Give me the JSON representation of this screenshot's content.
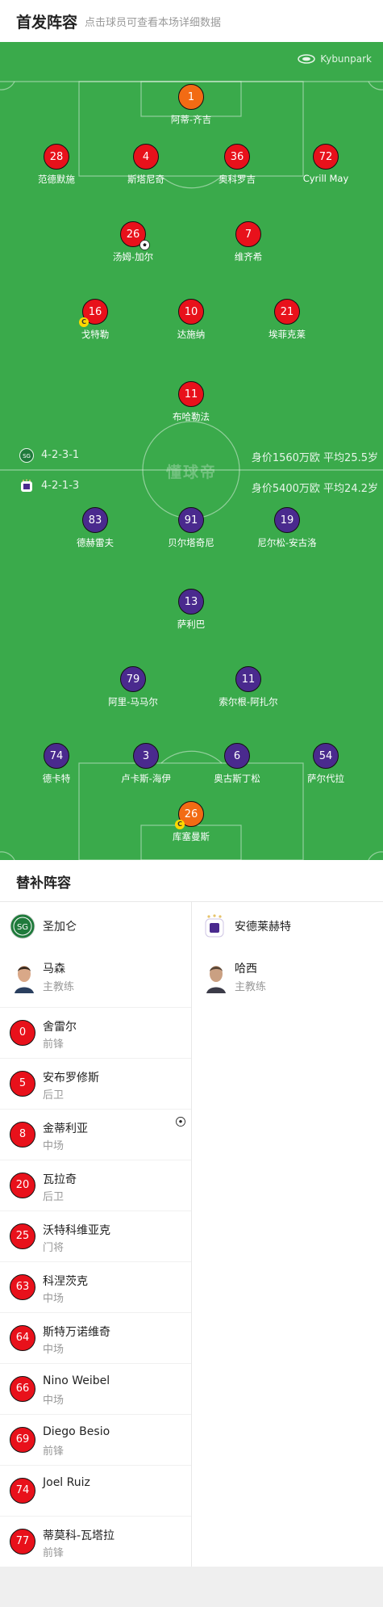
{
  "header": {
    "title": "首发阵容",
    "subtitle": "点击球员可查看本场详细数据"
  },
  "pitch": {
    "brand": "Kybunpark",
    "watermark": "懂球帝",
    "home_formation": "4-2-3-1",
    "home_value": "身价1560万欧 平均25.5岁",
    "away_formation": "4-2-1-3",
    "away_value": "身价5400万欧 平均24.2岁",
    "colors": {
      "pitch": "#3aaa4b",
      "home": "#e8111b",
      "goalkeeper": "#f26b14",
      "away": "#4a2a8e"
    }
  },
  "home_lineup": [
    {
      "number": "1",
      "name": "阿蒂-齐吉",
      "role": "gk"
    },
    {
      "number": "28",
      "name": "范德默施"
    },
    {
      "number": "4",
      "name": "斯塔尼奇"
    },
    {
      "number": "36",
      "name": "奥科罗吉"
    },
    {
      "number": "72",
      "name": "Cyrill May"
    },
    {
      "number": "26",
      "name": "汤姆-加尔",
      "event": "goal"
    },
    {
      "number": "7",
      "name": "维齐希"
    },
    {
      "number": "16",
      "name": "戈特勒",
      "event": "yellow-card",
      "card": "C"
    },
    {
      "number": "10",
      "name": "达施纳"
    },
    {
      "number": "21",
      "name": "埃菲克莱"
    },
    {
      "number": "11",
      "name": "布哈勒法"
    }
  ],
  "away_lineup": [
    {
      "number": "83",
      "name": "德赫雷夫"
    },
    {
      "number": "91",
      "name": "贝尔塔奇尼"
    },
    {
      "number": "19",
      "name": "尼尔松-安古洛"
    },
    {
      "number": "13",
      "name": "萨利巴"
    },
    {
      "number": "79",
      "name": "阿里-马马尔"
    },
    {
      "number": "11",
      "name": "索尔根-阿扎尔"
    },
    {
      "number": "74",
      "name": "德卡特"
    },
    {
      "number": "3",
      "name": "卢卡斯-海伊"
    },
    {
      "number": "6",
      "name": "奥古斯丁松"
    },
    {
      "number": "54",
      "name": "萨尔代拉"
    },
    {
      "number": "26",
      "name": "库塞曼斯",
      "role": "gk",
      "event": "yellow-card",
      "card": "C"
    }
  ],
  "subs": {
    "title": "替补阵容",
    "home": {
      "team": "圣加仑",
      "coach": {
        "name": "马森",
        "role": "主教练"
      },
      "players": [
        {
          "number": "0",
          "name": "舍雷尔",
          "position": "前锋"
        },
        {
          "number": "5",
          "name": "安布罗修斯",
          "position": "后卫"
        },
        {
          "number": "8",
          "name": "金蒂利亚",
          "position": "中场",
          "event": "goal"
        },
        {
          "number": "20",
          "name": "瓦拉奇",
          "position": "后卫"
        },
        {
          "number": "25",
          "name": "沃特科维亚克",
          "position": "门将"
        },
        {
          "number": "63",
          "name": "科涅茨克",
          "position": "中场"
        },
        {
          "number": "64",
          "name": "斯特万诺维奇",
          "position": "中场"
        },
        {
          "number": "66",
          "name": "Nino Weibel",
          "position": "中场"
        },
        {
          "number": "69",
          "name": "Diego Besio",
          "position": "前锋"
        },
        {
          "number": "74",
          "name": "Joel Ruiz",
          "position": ""
        },
        {
          "number": "77",
          "name": "蒂莫科-瓦塔拉",
          "position": "前锋"
        }
      ]
    },
    "away": {
      "team": "安德莱赫特",
      "coach": {
        "name": "哈西",
        "role": "主教练"
      },
      "players": []
    }
  }
}
